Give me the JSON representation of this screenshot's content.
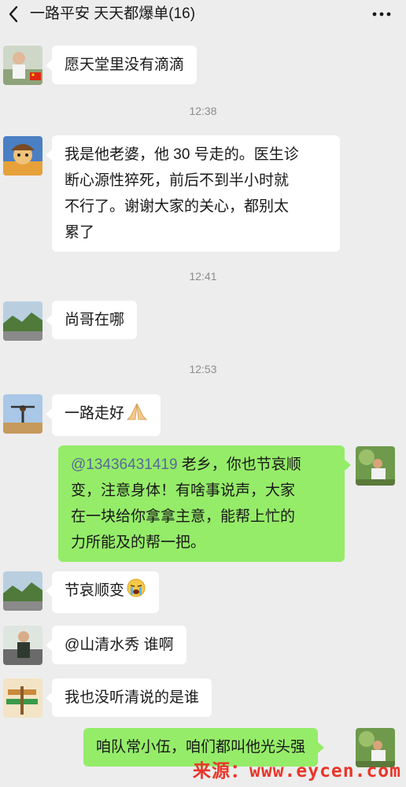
{
  "header": {
    "title": "一路平安 天天都爆单(16)"
  },
  "messages": [
    {
      "id": "m1",
      "text": "愿天堂里没有滴滴"
    },
    {
      "id": "t1",
      "time": "12:38"
    },
    {
      "id": "m2",
      "lines": [
        "我是他老婆，他 30 号走的。医生诊",
        "断心源性猝死，前后不到半小时就",
        "不行了。谢谢大家的关心，都别太",
        "累了"
      ]
    },
    {
      "id": "t2",
      "time": "12:41"
    },
    {
      "id": "m3",
      "text": "尚哥在哪"
    },
    {
      "id": "t3",
      "time": "12:53"
    },
    {
      "id": "m4",
      "text": "一路走好"
    },
    {
      "id": "m5",
      "mention": "@13436431419",
      "line1_rest": " 老乡，你也节哀顺",
      "lines": [
        "变，注意身体！有啥事说声，大家",
        "在一块给你拿拿主意，能帮上忙的",
        "力所能及的帮一把。"
      ]
    },
    {
      "id": "m6",
      "text": "节哀顺变"
    },
    {
      "id": "m7",
      "text": "@山清水秀  谁啊"
    },
    {
      "id": "m8",
      "text": "我也没听清说的是谁"
    },
    {
      "id": "m9",
      "text": "咱队常小伍，咱们都叫他光头强"
    }
  ],
  "icons": {
    "back": "chevron-left-icon",
    "more": "more-dots-icon",
    "emoji_pray": "folded-hands-emoji",
    "emoji_cry": "crying-face-emoji"
  },
  "colors": {
    "background": "#ededed",
    "incoming_bubble": "#ffffff",
    "outgoing_bubble": "#95ec69",
    "mention": "#576b95",
    "timestamp": "#8c8c8c",
    "watermark": "#e8362a"
  },
  "watermark": "来源：www.eycen.com"
}
